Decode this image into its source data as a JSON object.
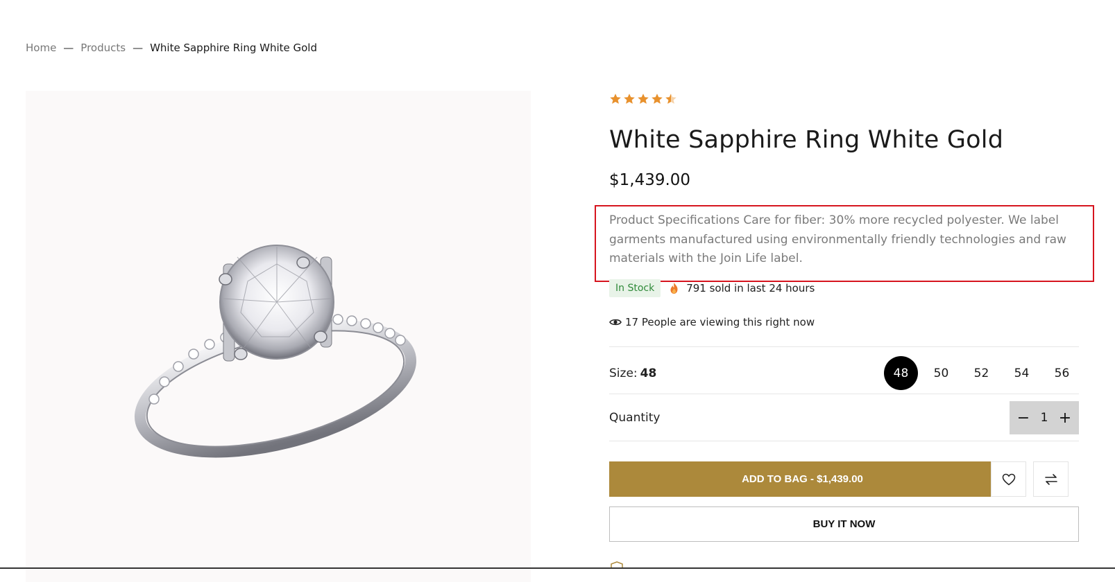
{
  "breadcrumb": {
    "home": "Home",
    "separator": "—",
    "products": "Products",
    "current": "White Sapphire Ring White Gold"
  },
  "product": {
    "rating": 4.5,
    "rating_max": 5,
    "title": "White Sapphire Ring White Gold",
    "price": "$1,439.00",
    "description": "Product Specifications Care for fiber: 30% more recycled polyester. We label garments manufactured using environmentally friendly technologies and raw materials with the Join Life label.",
    "stock_status": "In Stock",
    "sold_text": "791 sold in last 24 hours",
    "viewing_text": "17 People are viewing this right now"
  },
  "size": {
    "label": "Size:",
    "selected": "48",
    "options": [
      "48",
      "50",
      "52",
      "54",
      "56"
    ]
  },
  "quantity": {
    "label": "Quantity",
    "value": "1",
    "minus_glyph": "−",
    "plus_glyph": "+"
  },
  "actions": {
    "add_to_bag": "ADD TO BAG  - $1,439.00",
    "buy_now": "BUY IT NOW"
  },
  "icons": {
    "star": "star-icon",
    "fire": "fire-icon",
    "eye": "eye-icon",
    "wishlist": "heart-icon",
    "compare": "compare-arrows-icon",
    "shield": "shield-icon"
  },
  "colors": {
    "accent_gold": "#ac893b",
    "star_orange": "#e8912d",
    "stock_green": "#2f8a39",
    "stock_bg": "#e8f3e8",
    "highlight_red": "#d6141e",
    "selected_size": "#000000"
  }
}
